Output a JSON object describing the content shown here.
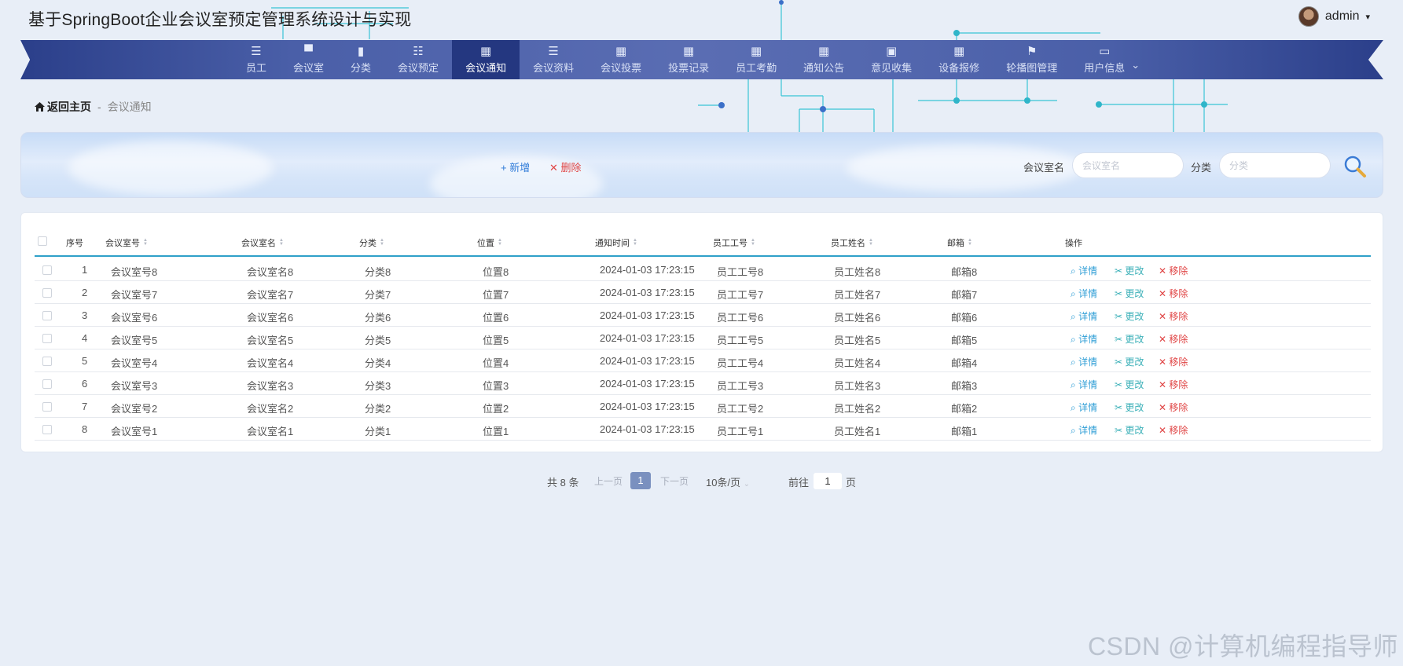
{
  "app": {
    "title": "基于SpringBoot企业会议室预定管理系统设计与实现"
  },
  "user": {
    "name": "admin",
    "caret": "▾"
  },
  "nav": {
    "items": [
      {
        "label": "员工",
        "icon": "list-icon",
        "glyph": "☰"
      },
      {
        "label": "会议室",
        "icon": "chair-icon",
        "glyph": "▀"
      },
      {
        "label": "分类",
        "icon": "bar-chart-icon",
        "glyph": "▮"
      },
      {
        "label": "会议预定",
        "icon": "sliders-icon",
        "glyph": "☷"
      },
      {
        "label": "会议通知",
        "icon": "grid-icon",
        "glyph": "▦"
      },
      {
        "label": "会议资料",
        "icon": "list-indent-icon",
        "glyph": "☰"
      },
      {
        "label": "会议投票",
        "icon": "grid-icon",
        "glyph": "▦"
      },
      {
        "label": "投票记录",
        "icon": "grid-icon",
        "glyph": "▦"
      },
      {
        "label": "员工考勤",
        "icon": "grid-icon",
        "glyph": "▦"
      },
      {
        "label": "通知公告",
        "icon": "grid-icon",
        "glyph": "▦"
      },
      {
        "label": "意见收集",
        "icon": "briefcase-icon",
        "glyph": "▣"
      },
      {
        "label": "设备报修",
        "icon": "grid-icon",
        "glyph": "▦"
      },
      {
        "label": "轮播图管理",
        "icon": "flag-icon",
        "glyph": "⚑"
      },
      {
        "label": "用户信息",
        "icon": "window-icon",
        "glyph": "▭"
      }
    ],
    "active_index": 4,
    "more_caret": "⌄"
  },
  "breadcrumb": {
    "home": "返回主页",
    "separator": "-",
    "current": "会议通知",
    "home_icon": "home-icon"
  },
  "toolbar": {
    "add_label": "+ 新增",
    "delete_label": "✕ 删除"
  },
  "search": {
    "room_label": "会议室名",
    "room_placeholder": "会议室名",
    "category_label": "分类",
    "category_placeholder": "分类"
  },
  "table": {
    "headers": [
      "序号",
      "会议室号",
      "会议室名",
      "分类",
      "位置",
      "通知时间",
      "员工工号",
      "员工姓名",
      "邮箱",
      "操作"
    ],
    "rows": [
      {
        "idx": "1",
        "room_no": "会议室号8",
        "room_name": "会议室名8",
        "category": "分类8",
        "location": "位置8",
        "time": "2024-01-03 17:23:15",
        "emp_no": "员工工号8",
        "emp_name": "员工姓名8",
        "email": "邮箱8"
      },
      {
        "idx": "2",
        "room_no": "会议室号7",
        "room_name": "会议室名7",
        "category": "分类7",
        "location": "位置7",
        "time": "2024-01-03 17:23:15",
        "emp_no": "员工工号7",
        "emp_name": "员工姓名7",
        "email": "邮箱7"
      },
      {
        "idx": "3",
        "room_no": "会议室号6",
        "room_name": "会议室名6",
        "category": "分类6",
        "location": "位置6",
        "time": "2024-01-03 17:23:15",
        "emp_no": "员工工号6",
        "emp_name": "员工姓名6",
        "email": "邮箱6"
      },
      {
        "idx": "4",
        "room_no": "会议室号5",
        "room_name": "会议室名5",
        "category": "分类5",
        "location": "位置5",
        "time": "2024-01-03 17:23:15",
        "emp_no": "员工工号5",
        "emp_name": "员工姓名5",
        "email": "邮箱5"
      },
      {
        "idx": "5",
        "room_no": "会议室号4",
        "room_name": "会议室名4",
        "category": "分类4",
        "location": "位置4",
        "time": "2024-01-03 17:23:15",
        "emp_no": "员工工号4",
        "emp_name": "员工姓名4",
        "email": "邮箱4"
      },
      {
        "idx": "6",
        "room_no": "会议室号3",
        "room_name": "会议室名3",
        "category": "分类3",
        "location": "位置3",
        "time": "2024-01-03 17:23:15",
        "emp_no": "员工工号3",
        "emp_name": "员工姓名3",
        "email": "邮箱3"
      },
      {
        "idx": "7",
        "room_no": "会议室号2",
        "room_name": "会议室名2",
        "category": "分类2",
        "location": "位置2",
        "time": "2024-01-03 17:23:15",
        "emp_no": "员工工号2",
        "emp_name": "员工姓名2",
        "email": "邮箱2"
      },
      {
        "idx": "8",
        "room_no": "会议室号1",
        "room_name": "会议室名1",
        "category": "分类1",
        "location": "位置1",
        "time": "2024-01-03 17:23:15",
        "emp_no": "员工工号1",
        "emp_name": "员工姓名1",
        "email": "邮箱1"
      }
    ],
    "actions": {
      "detail": "详情",
      "edit": "更改",
      "remove": "移除"
    }
  },
  "pagination": {
    "total": "共 8 条",
    "prev": "上一页",
    "current_page": "1",
    "next": "下一页",
    "page_size": "10条/页",
    "goto_label": "前往",
    "goto_value": "1",
    "page_suffix": "页"
  },
  "watermark": "CSDN @计算机编程指导师",
  "colors": {
    "nav_bg": "#4a5fa8",
    "nav_active": "#243780",
    "accent": "#2fa0c9",
    "danger": "#e04545"
  }
}
